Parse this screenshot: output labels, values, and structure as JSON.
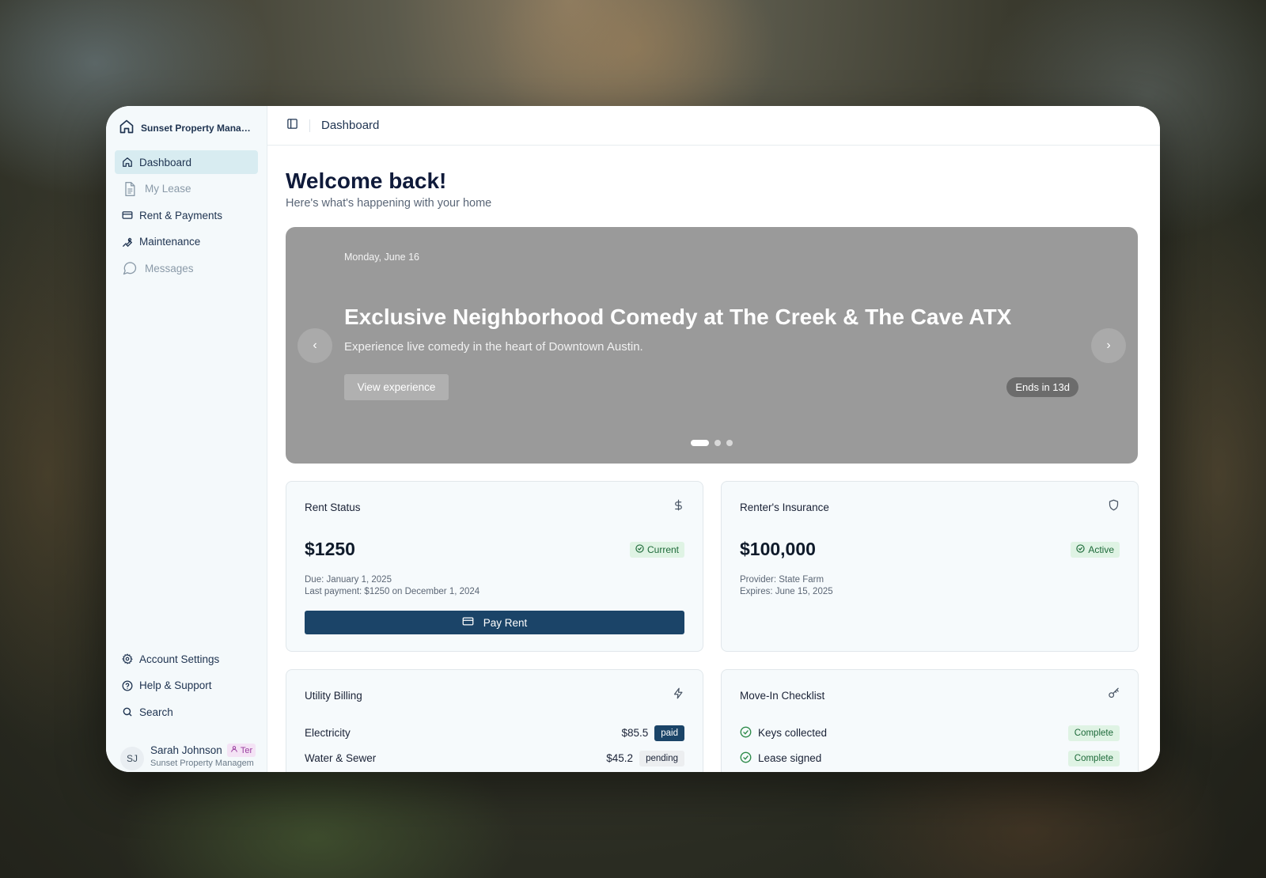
{
  "app": {
    "brand_name": "Sunset Property Manage..."
  },
  "sidebar": {
    "items": [
      {
        "label": "Dashboard",
        "icon": "home-icon",
        "state": "active"
      },
      {
        "label": "My Lease",
        "icon": "document-icon",
        "state": "muted"
      },
      {
        "label": "Rent & Payments",
        "icon": "credit-card-icon",
        "state": "normal"
      },
      {
        "label": "Maintenance",
        "icon": "wrench-icon",
        "state": "normal"
      },
      {
        "label": "Messages",
        "icon": "chat-bubble-icon",
        "state": "muted"
      }
    ],
    "bottom_items": [
      {
        "label": "Account Settings",
        "icon": "gear-icon"
      },
      {
        "label": "Help & Support",
        "icon": "help-circle-icon"
      },
      {
        "label": "Search",
        "icon": "search-icon"
      }
    ],
    "user": {
      "initials": "SJ",
      "name": "Sarah Johnson",
      "role": "Ter",
      "org": "Sunset Property Managem"
    }
  },
  "topbar": {
    "title": "Dashboard"
  },
  "welcome": {
    "title": "Welcome back!",
    "subtitle": "Here's what's happening with your home"
  },
  "hero": {
    "date": "Monday, June 16",
    "title": "Exclusive Neighborhood Comedy at The Creek & The Cave ATX",
    "subtitle": "Experience live comedy in the heart of Downtown Austin.",
    "button_label": "View experience",
    "ends_label": "Ends in 13d",
    "prev_arrow": "‹",
    "next_arrow": "›",
    "slide_count": 3,
    "active_slide": 1
  },
  "cards": {
    "rent": {
      "title": "Rent Status",
      "amount": "$1250",
      "status": "Current",
      "due": "Due: January 1, 2025",
      "last_payment": "Last payment: $1250 on December 1, 2024",
      "button_label": "Pay Rent"
    },
    "insurance": {
      "title": "Renter's Insurance",
      "amount": "$100,000",
      "status": "Active",
      "provider": "Provider: State Farm",
      "expires": "Expires: June 15, 2025"
    },
    "utility": {
      "title": "Utility Billing",
      "rows": [
        {
          "label": "Electricity",
          "amount": "$85.5",
          "status": "paid"
        },
        {
          "label": "Water & Sewer",
          "amount": "$45.2",
          "status": "pending"
        }
      ]
    },
    "checklist": {
      "title": "Move-In Checklist",
      "rows": [
        {
          "label": "Keys collected",
          "status": "Complete"
        },
        {
          "label": "Lease signed",
          "status": "Complete"
        }
      ]
    }
  },
  "colors": {
    "primary": "#1b4468",
    "active_nav_bg": "#d8ecf1",
    "success_bg": "#dff3e4",
    "success_text": "#1e6a3a",
    "hero_bg": "#9a9a9a"
  }
}
